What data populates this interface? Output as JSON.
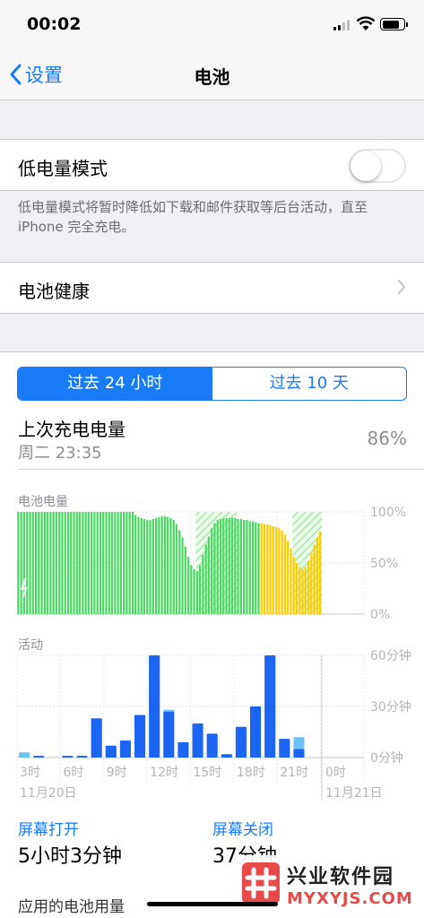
{
  "status": {
    "time": "00:02"
  },
  "nav": {
    "back_label": "设置",
    "title": "电池"
  },
  "low_power": {
    "label": "低电量模式",
    "enabled": false,
    "footnote": "低电量模式将暂时降低如下载和邮件获取等后台活动，直至iPhone 完全充电。"
  },
  "battery_health": {
    "label": "电池健康"
  },
  "segment": {
    "options": [
      "过去 24 小时",
      "过去 10 天"
    ],
    "selected": 0
  },
  "last_charge": {
    "title": "上次充电电量",
    "date": "周二 23:35",
    "percent": "86%"
  },
  "battery_chart_title": "电池电量",
  "activity_chart_title": "活动",
  "chart_data": [
    {
      "type": "bar",
      "title": "电池电量",
      "ylim": [
        0,
        100
      ],
      "y_ticks": [
        "100%",
        "50%",
        "0%"
      ],
      "values": [
        100,
        100,
        100,
        100,
        100,
        100,
        100,
        100,
        100,
        100,
        100,
        100,
        100,
        100,
        100,
        100,
        100,
        100,
        100,
        100,
        100,
        100,
        100,
        100,
        100,
        100,
        100,
        100,
        100,
        100,
        100,
        100,
        100,
        100,
        100,
        100,
        100,
        100,
        100,
        100,
        97,
        95,
        94,
        93,
        92,
        92,
        93,
        94,
        95,
        96,
        96,
        95,
        94,
        92,
        88,
        82,
        75,
        66,
        56,
        48,
        44,
        42,
        48,
        58,
        68,
        76,
        84,
        89,
        92,
        93,
        94,
        94,
        94,
        94,
        94,
        93,
        93,
        92,
        92,
        91,
        91,
        90,
        89,
        89,
        88,
        88,
        87,
        86,
        85,
        84,
        82,
        78,
        72,
        64,
        56,
        50,
        46,
        44,
        46,
        52,
        60,
        68,
        75,
        81
      ],
      "series_colors": {
        "normal": "#4cd964",
        "low_power": "#ffcc00"
      },
      "low_power_start_index": 83,
      "charging_hatch_ranges": [
        [
          61,
          74
        ],
        [
          94,
          103
        ]
      ]
    },
    {
      "type": "bar",
      "title": "活动",
      "ylim": [
        0,
        60
      ],
      "y_ticks": [
        "60分钟",
        "30分钟",
        "0分钟"
      ],
      "categories": [
        "3时",
        "6时",
        "9时",
        "12时",
        "15时",
        "18时",
        "21时",
        "0时"
      ],
      "date_labels": [
        "11月20日",
        "11月21日"
      ],
      "series": [
        {
          "name": "屏幕打开",
          "color": "#1c64f2",
          "values": [
            0,
            1,
            0,
            1,
            1,
            23,
            7,
            10,
            25,
            60,
            27,
            9,
            20,
            14,
            2,
            18,
            30,
            60,
            11,
            5
          ]
        },
        {
          "name": "屏幕关闭",
          "color": "#6ec1f0",
          "values": [
            3,
            0,
            0,
            0,
            0,
            0,
            0,
            0,
            0,
            0,
            1,
            0,
            0,
            0,
            0,
            0,
            0,
            0,
            0,
            7
          ]
        }
      ]
    }
  ],
  "stats": {
    "screen_on_label": "屏幕打开",
    "screen_on_value": "5小时3分钟",
    "screen_off_label": "屏幕关闭",
    "screen_off_value": "37分钟"
  },
  "usage_label": "应用的电池用量",
  "watermark": {
    "cn": "兴业软件园",
    "en": "MYXYJS.COM"
  }
}
